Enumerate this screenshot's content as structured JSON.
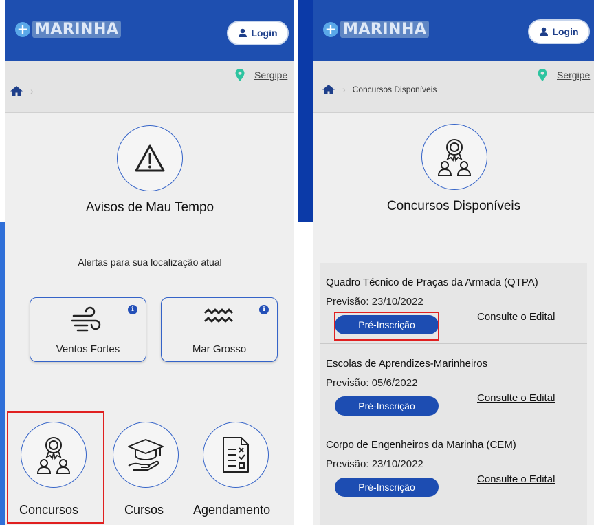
{
  "app": {
    "logo_symbol": "+",
    "logo_text": "MARINHA"
  },
  "login_label": "Login",
  "location": "Sergipe",
  "left": {
    "alert_title": "Avisos de Mau Tempo",
    "alert_subtitle": "Alertas para sua localização atual",
    "alert_cards": [
      {
        "label": "Ventos Fortes",
        "icon": "wind-icon",
        "info": "i"
      },
      {
        "label": "Mar Grosso",
        "icon": "waves-icon",
        "info": "i"
      }
    ],
    "features": [
      {
        "label": "Concursos",
        "icon": "contest-award-icon"
      },
      {
        "label": "Cursos",
        "icon": "graduation-cap-icon"
      },
      {
        "label": "Agendamento",
        "icon": "checklist-icon"
      }
    ]
  },
  "right": {
    "breadcrumb": "Concursos Disponíveis",
    "title": "Concursos Disponíveis",
    "contests": [
      {
        "title": "Quadro Técnico de Praças da Armada (QTPA)",
        "forecast": "Previsão:  23/10/2022",
        "button": "Pré-Inscrição",
        "link": "Consulte o Edital"
      },
      {
        "title": "Escolas de Aprendizes-Marinheiros",
        "forecast": "Previsão:  05/6/2022",
        "button": "Pré-Inscrição",
        "link": "Consulte o Edital"
      },
      {
        "title": "Corpo de Engenheiros da Marinha (CEM)",
        "forecast": "Previsão:  23/10/2022",
        "button": "Pré-Inscrição",
        "link": "Consulte o Edital"
      }
    ]
  },
  "colors": {
    "header": "#1e4fb0",
    "accent": "#1d4db2",
    "highlight": "#e02020",
    "pin": "#2ec4a0"
  }
}
